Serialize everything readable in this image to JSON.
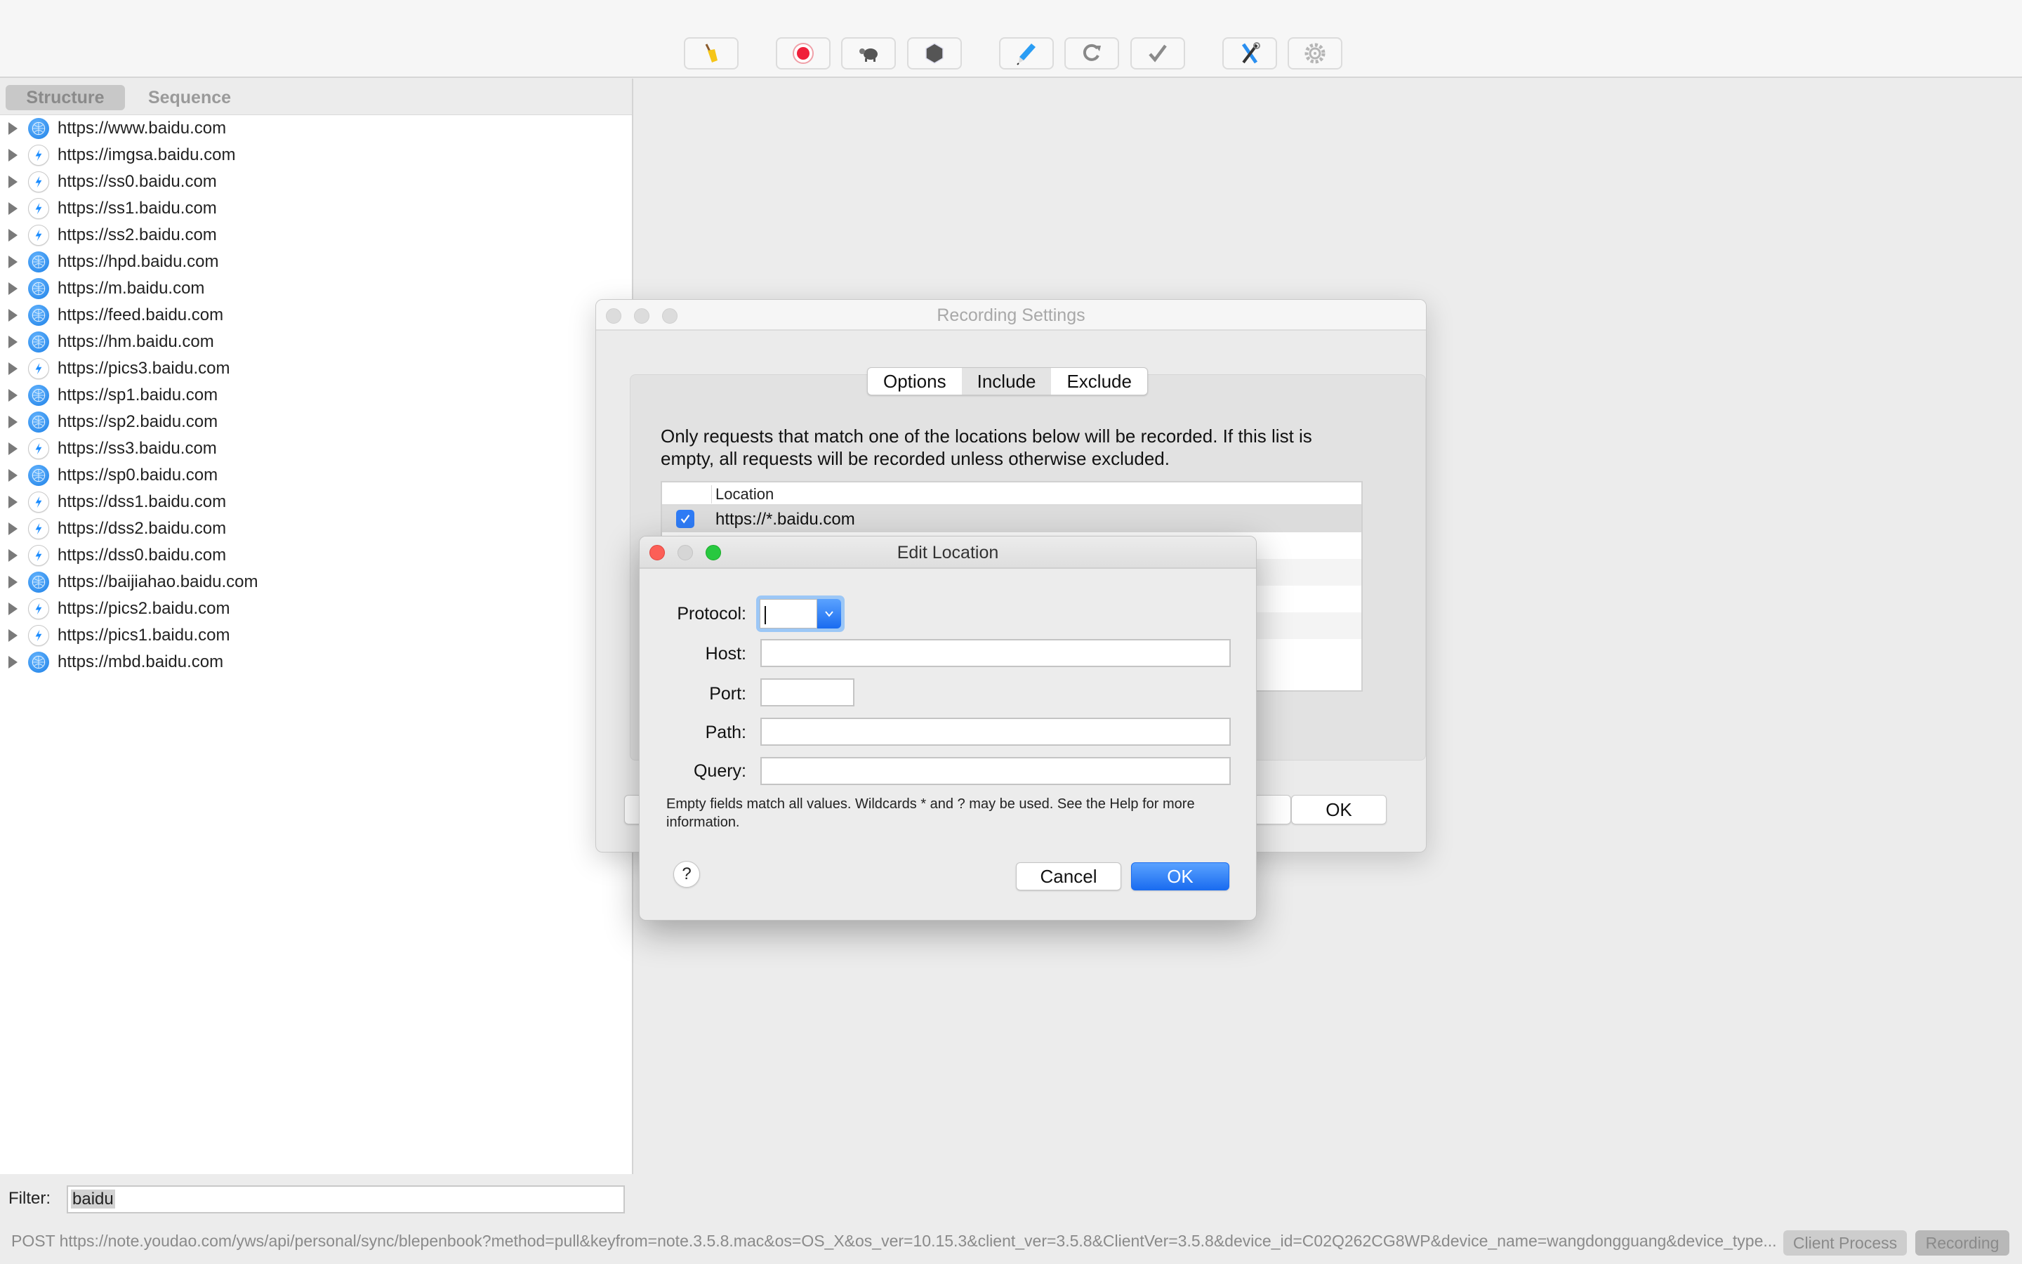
{
  "toolbar": {
    "buttons": [
      {
        "name": "clear-session",
        "icon": "broom-icon"
      },
      {
        "name": "start-recording",
        "icon": "record-icon"
      },
      {
        "name": "throttle",
        "icon": "turtle-icon"
      },
      {
        "name": "breakpoints",
        "icon": "stop-hexagon-icon"
      },
      {
        "name": "compose",
        "icon": "pen-icon"
      },
      {
        "name": "repeat",
        "icon": "refresh-icon"
      },
      {
        "name": "validate",
        "icon": "checkmark-icon"
      },
      {
        "name": "tools",
        "icon": "tools-icon"
      },
      {
        "name": "settings",
        "icon": "gear-icon"
      }
    ]
  },
  "view_tabs": {
    "structure": "Structure",
    "sequence": "Sequence",
    "active": "Structure"
  },
  "hosts": [
    {
      "url": "https://www.baidu.com",
      "icon": "globe"
    },
    {
      "url": "https://imgsa.baidu.com",
      "icon": "bolt"
    },
    {
      "url": "https://ss0.baidu.com",
      "icon": "bolt"
    },
    {
      "url": "https://ss1.baidu.com",
      "icon": "bolt"
    },
    {
      "url": "https://ss2.baidu.com",
      "icon": "bolt"
    },
    {
      "url": "https://hpd.baidu.com",
      "icon": "globe"
    },
    {
      "url": "https://m.baidu.com",
      "icon": "globe"
    },
    {
      "url": "https://feed.baidu.com",
      "icon": "globe"
    },
    {
      "url": "https://hm.baidu.com",
      "icon": "globe"
    },
    {
      "url": "https://pics3.baidu.com",
      "icon": "bolt"
    },
    {
      "url": "https://sp1.baidu.com",
      "icon": "globe"
    },
    {
      "url": "https://sp2.baidu.com",
      "icon": "globe"
    },
    {
      "url": "https://ss3.baidu.com",
      "icon": "bolt"
    },
    {
      "url": "https://sp0.baidu.com",
      "icon": "globe"
    },
    {
      "url": "https://dss1.baidu.com",
      "icon": "bolt"
    },
    {
      "url": "https://dss2.baidu.com",
      "icon": "bolt"
    },
    {
      "url": "https://dss0.baidu.com",
      "icon": "bolt"
    },
    {
      "url": "https://baijiahao.baidu.com",
      "icon": "globe"
    },
    {
      "url": "https://pics2.baidu.com",
      "icon": "bolt"
    },
    {
      "url": "https://pics1.baidu.com",
      "icon": "bolt"
    },
    {
      "url": "https://mbd.baidu.com",
      "icon": "globe"
    }
  ],
  "filter": {
    "label": "Filter:",
    "value": "baidu"
  },
  "status_bar": {
    "text": "POST https://note.youdao.com/yws/api/personal/sync/blepenbook?method=pull&keyfrom=note.3.5.8.mac&os=OS_X&os_ver=10.15.3&client_ver=3.5.8&ClientVer=3.5.8&device_id=C02Q262CG8WP&device_name=wangdongguang&device_type...",
    "client_process": "Client Process",
    "recording": "Recording"
  },
  "recording_settings": {
    "title": "Recording Settings",
    "tabs": [
      "Options",
      "Include",
      "Exclude"
    ],
    "selected_tab": "Include",
    "description": "Only requests that match one of the locations below will be recorded. If this list is empty, all requests will be recorded unless otherwise excluded.",
    "table": {
      "column_header": "Location",
      "rows": [
        {
          "enabled": true,
          "location": "https://*.baidu.com"
        }
      ]
    },
    "ok_label": "OK"
  },
  "edit_location": {
    "title": "Edit Location",
    "fields": {
      "protocol": {
        "label": "Protocol:",
        "value": ""
      },
      "host": {
        "label": "Host:",
        "value": ""
      },
      "port": {
        "label": "Port:",
        "value": ""
      },
      "path": {
        "label": "Path:",
        "value": ""
      },
      "query": {
        "label": "Query:",
        "value": ""
      }
    },
    "note": "Empty fields match all values. Wildcards * and ? may be used. See the Help for more information.",
    "help_label": "?",
    "cancel_label": "Cancel",
    "ok_label": "OK",
    "accent_color": "#1a6cf0"
  }
}
